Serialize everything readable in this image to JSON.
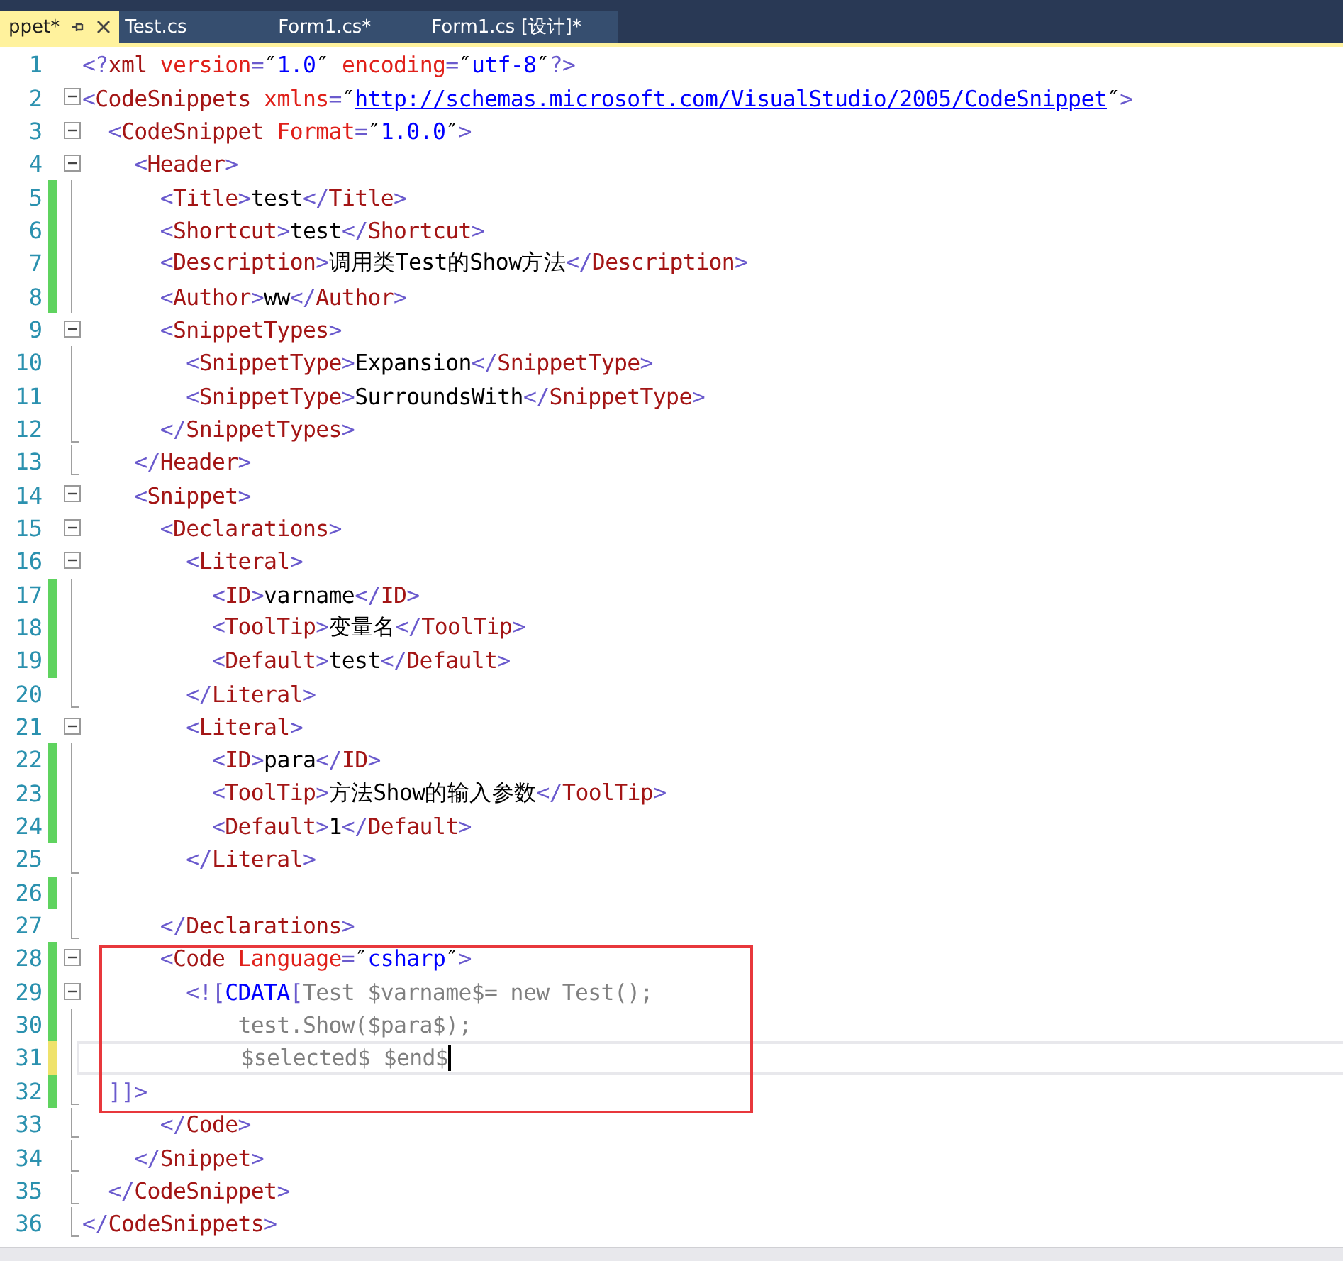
{
  "tabs": [
    {
      "label": "ppet*",
      "selected": true,
      "pinned": true
    },
    {
      "label": "Test.cs",
      "selected": false,
      "pinned": false
    },
    {
      "label": "Form1.cs*",
      "selected": false,
      "pinned": false
    },
    {
      "label": "Form1.cs [设计]*",
      "selected": false,
      "pinned": false
    }
  ],
  "lines": [
    {
      "number": "1",
      "tokens": [
        {
          "kind": "delim",
          "text": "<?"
        },
        {
          "kind": "tag",
          "text": "xml"
        },
        {
          "kind": "attr",
          "text": " version"
        },
        {
          "kind": "delim",
          "text": "="
        },
        {
          "kind": "quote",
          "text": "″"
        },
        {
          "kind": "value",
          "text": "1.0"
        },
        {
          "kind": "quote",
          "text": "″"
        },
        {
          "kind": "attr",
          "text": " encoding"
        },
        {
          "kind": "delim",
          "text": "="
        },
        {
          "kind": "quote",
          "text": "″"
        },
        {
          "kind": "value",
          "text": "utf-8"
        },
        {
          "kind": "quote",
          "text": "″"
        },
        {
          "kind": "delim",
          "text": "?>"
        }
      ]
    },
    {
      "number": "2",
      "collapsible": true,
      "tokens": [
        {
          "kind": "delim",
          "text": "<"
        },
        {
          "kind": "tag",
          "text": "CodeSnippets"
        },
        {
          "kind": "attr",
          "text": " xmlns"
        },
        {
          "kind": "delim",
          "text": "="
        },
        {
          "kind": "quote",
          "text": "″"
        },
        {
          "kind": "link",
          "text": "http://schemas.microsoft.com/VisualStudio/2005/CodeSnippet"
        },
        {
          "kind": "quote",
          "text": "″"
        },
        {
          "kind": "delim",
          "text": ">"
        }
      ]
    },
    {
      "number": "3",
      "collapsible": true,
      "tokens": [
        {
          "kind": "delim",
          "text": "  <"
        },
        {
          "kind": "tag",
          "text": "CodeSnippet"
        },
        {
          "kind": "attr",
          "text": " Format"
        },
        {
          "kind": "delim",
          "text": "="
        },
        {
          "kind": "quote",
          "text": "″"
        },
        {
          "kind": "value",
          "text": "1.0.0"
        },
        {
          "kind": "quote",
          "text": "″"
        },
        {
          "kind": "delim",
          "text": ">"
        }
      ]
    },
    {
      "number": "4",
      "collapsible": true,
      "tokens": [
        {
          "kind": "delim",
          "text": "    <"
        },
        {
          "kind": "tag",
          "text": "Header"
        },
        {
          "kind": "delim",
          "text": ">"
        }
      ]
    },
    {
      "number": "5",
      "modified": true,
      "saved": true,
      "tokens": [
        {
          "kind": "delim",
          "text": "      <"
        },
        {
          "kind": "tag",
          "text": "Title"
        },
        {
          "kind": "delim",
          "text": ">"
        },
        {
          "kind": "text",
          "text": "test"
        },
        {
          "kind": "delim",
          "text": "</"
        },
        {
          "kind": "tag",
          "text": "Title"
        },
        {
          "kind": "delim",
          "text": ">"
        }
      ]
    },
    {
      "number": "6",
      "modified": true,
      "saved": true,
      "tokens": [
        {
          "kind": "delim",
          "text": "      <"
        },
        {
          "kind": "tag",
          "text": "Shortcut"
        },
        {
          "kind": "delim",
          "text": ">"
        },
        {
          "kind": "text",
          "text": "test"
        },
        {
          "kind": "delim",
          "text": "</"
        },
        {
          "kind": "tag",
          "text": "Shortcut"
        },
        {
          "kind": "delim",
          "text": ">"
        }
      ]
    },
    {
      "number": "7",
      "modified": true,
      "saved": true,
      "tokens": [
        {
          "kind": "delim",
          "text": "      <"
        },
        {
          "kind": "tag",
          "text": "Description"
        },
        {
          "kind": "delim",
          "text": ">"
        },
        {
          "kind": "text",
          "text": "调用类Test的Show方法"
        },
        {
          "kind": "delim",
          "text": "</"
        },
        {
          "kind": "tag",
          "text": "Description"
        },
        {
          "kind": "delim",
          "text": ">"
        }
      ]
    },
    {
      "number": "8",
      "modified": true,
      "saved": true,
      "tokens": [
        {
          "kind": "delim",
          "text": "      <"
        },
        {
          "kind": "tag",
          "text": "Author"
        },
        {
          "kind": "delim",
          "text": ">"
        },
        {
          "kind": "text",
          "text": "ww"
        },
        {
          "kind": "delim",
          "text": "</"
        },
        {
          "kind": "tag",
          "text": "Author"
        },
        {
          "kind": "delim",
          "text": ">"
        }
      ]
    },
    {
      "number": "9",
      "collapsible": true,
      "tokens": [
        {
          "kind": "delim",
          "text": "      <"
        },
        {
          "kind": "tag",
          "text": "SnippetTypes"
        },
        {
          "kind": "delim",
          "text": ">"
        }
      ]
    },
    {
      "number": "10",
      "tokens": [
        {
          "kind": "delim",
          "text": "        <"
        },
        {
          "kind": "tag",
          "text": "SnippetType"
        },
        {
          "kind": "delim",
          "text": ">"
        },
        {
          "kind": "text",
          "text": "Expansion"
        },
        {
          "kind": "delim",
          "text": "</"
        },
        {
          "kind": "tag",
          "text": "SnippetType"
        },
        {
          "kind": "delim",
          "text": ">"
        }
      ]
    },
    {
      "number": "11",
      "tokens": [
        {
          "kind": "delim",
          "text": "        <"
        },
        {
          "kind": "tag",
          "text": "SnippetType"
        },
        {
          "kind": "delim",
          "text": ">"
        },
        {
          "kind": "text",
          "text": "SurroundsWith"
        },
        {
          "kind": "delim",
          "text": "</"
        },
        {
          "kind": "tag",
          "text": "SnippetType"
        },
        {
          "kind": "delim",
          "text": ">"
        }
      ]
    },
    {
      "number": "12",
      "closes_block": true,
      "tokens": [
        {
          "kind": "delim",
          "text": "      </"
        },
        {
          "kind": "tag",
          "text": "SnippetTypes"
        },
        {
          "kind": "delim",
          "text": ">"
        }
      ]
    },
    {
      "number": "13",
      "closes_block": true,
      "tokens": [
        {
          "kind": "delim",
          "text": "    </"
        },
        {
          "kind": "tag",
          "text": "Header"
        },
        {
          "kind": "delim",
          "text": ">"
        }
      ]
    },
    {
      "number": "14",
      "collapsible": true,
      "tokens": [
        {
          "kind": "delim",
          "text": "    <"
        },
        {
          "kind": "tag",
          "text": "Snippet"
        },
        {
          "kind": "delim",
          "text": ">"
        }
      ]
    },
    {
      "number": "15",
      "collapsible": true,
      "tokens": [
        {
          "kind": "delim",
          "text": "      <"
        },
        {
          "kind": "tag",
          "text": "Declarations"
        },
        {
          "kind": "delim",
          "text": ">"
        }
      ]
    },
    {
      "number": "16",
      "collapsible": true,
      "tokens": [
        {
          "kind": "delim",
          "text": "        <"
        },
        {
          "kind": "tag",
          "text": "Literal"
        },
        {
          "kind": "delim",
          "text": ">"
        }
      ]
    },
    {
      "number": "17",
      "modified": true,
      "saved": true,
      "tokens": [
        {
          "kind": "delim",
          "text": "          <"
        },
        {
          "kind": "tag",
          "text": "ID"
        },
        {
          "kind": "delim",
          "text": ">"
        },
        {
          "kind": "text",
          "text": "varname"
        },
        {
          "kind": "delim",
          "text": "</"
        },
        {
          "kind": "tag",
          "text": "ID"
        },
        {
          "kind": "delim",
          "text": ">"
        }
      ]
    },
    {
      "number": "18",
      "modified": true,
      "saved": true,
      "tokens": [
        {
          "kind": "delim",
          "text": "          <"
        },
        {
          "kind": "tag",
          "text": "ToolTip"
        },
        {
          "kind": "delim",
          "text": ">"
        },
        {
          "kind": "text",
          "text": "变量名"
        },
        {
          "kind": "delim",
          "text": "</"
        },
        {
          "kind": "tag",
          "text": "ToolTip"
        },
        {
          "kind": "delim",
          "text": ">"
        }
      ]
    },
    {
      "number": "19",
      "modified": true,
      "saved": true,
      "tokens": [
        {
          "kind": "delim",
          "text": "          <"
        },
        {
          "kind": "tag",
          "text": "Default"
        },
        {
          "kind": "delim",
          "text": ">"
        },
        {
          "kind": "text",
          "text": "test"
        },
        {
          "kind": "delim",
          "text": "</"
        },
        {
          "kind": "tag",
          "text": "Default"
        },
        {
          "kind": "delim",
          "text": ">"
        }
      ]
    },
    {
      "number": "20",
      "closes_block": true,
      "tokens": [
        {
          "kind": "delim",
          "text": "        </"
        },
        {
          "kind": "tag",
          "text": "Literal"
        },
        {
          "kind": "delim",
          "text": ">"
        }
      ]
    },
    {
      "number": "21",
      "collapsible": true,
      "tokens": [
        {
          "kind": "delim",
          "text": "        <"
        },
        {
          "kind": "tag",
          "text": "Literal"
        },
        {
          "kind": "delim",
          "text": ">"
        }
      ]
    },
    {
      "number": "22",
      "modified": true,
      "saved": true,
      "tokens": [
        {
          "kind": "delim",
          "text": "          <"
        },
        {
          "kind": "tag",
          "text": "ID"
        },
        {
          "kind": "delim",
          "text": ">"
        },
        {
          "kind": "text",
          "text": "para"
        },
        {
          "kind": "delim",
          "text": "</"
        },
        {
          "kind": "tag",
          "text": "ID"
        },
        {
          "kind": "delim",
          "text": ">"
        }
      ]
    },
    {
      "number": "23",
      "modified": true,
      "saved": true,
      "tokens": [
        {
          "kind": "delim",
          "text": "          <"
        },
        {
          "kind": "tag",
          "text": "ToolTip"
        },
        {
          "kind": "delim",
          "text": ">"
        },
        {
          "kind": "text",
          "text": "方法Show的输入参数"
        },
        {
          "kind": "delim",
          "text": "</"
        },
        {
          "kind": "tag",
          "text": "ToolTip"
        },
        {
          "kind": "delim",
          "text": ">"
        }
      ]
    },
    {
      "number": "24",
      "modified": true,
      "saved": true,
      "tokens": [
        {
          "kind": "delim",
          "text": "          <"
        },
        {
          "kind": "tag",
          "text": "Default"
        },
        {
          "kind": "delim",
          "text": ">"
        },
        {
          "kind": "text",
          "text": "1"
        },
        {
          "kind": "delim",
          "text": "</"
        },
        {
          "kind": "tag",
          "text": "Default"
        },
        {
          "kind": "delim",
          "text": ">"
        }
      ]
    },
    {
      "number": "25",
      "closes_block": true,
      "tokens": [
        {
          "kind": "delim",
          "text": "        </"
        },
        {
          "kind": "tag",
          "text": "Literal"
        },
        {
          "kind": "delim",
          "text": ">"
        }
      ]
    },
    {
      "number": "26",
      "modified": true,
      "saved": true
    },
    {
      "number": "27",
      "closes_block": true,
      "tokens": [
        {
          "kind": "delim",
          "text": "      </"
        },
        {
          "kind": "tag",
          "text": "Declarations"
        },
        {
          "kind": "delim",
          "text": ">"
        }
      ]
    },
    {
      "number": "28",
      "modified": true,
      "saved": true,
      "collapsible": true,
      "boxed": true,
      "tokens": [
        {
          "kind": "delim",
          "text": "      <"
        },
        {
          "kind": "tag",
          "text": "Code"
        },
        {
          "kind": "attr",
          "text": " Language"
        },
        {
          "kind": "delim",
          "text": "="
        },
        {
          "kind": "quote",
          "text": "″"
        },
        {
          "kind": "value",
          "text": "csharp"
        },
        {
          "kind": "quote",
          "text": "″"
        },
        {
          "kind": "delim",
          "text": ">"
        }
      ]
    },
    {
      "number": "29",
      "modified": true,
      "saved": true,
      "collapsible": true,
      "boxed": true,
      "tokens": [
        {
          "kind": "delim",
          "text": "        <!["
        },
        {
          "kind": "cdata",
          "text": "CDATA"
        },
        {
          "kind": "delim",
          "text": "["
        },
        {
          "kind": "code",
          "text": "Test $varname$= new Test();"
        }
      ]
    },
    {
      "number": "30",
      "modified": true,
      "saved": true,
      "boxed": true,
      "tokens": [
        {
          "kind": "code",
          "text": "            test.Show($para$);"
        }
      ]
    },
    {
      "number": "31",
      "modified": true,
      "saved": false,
      "boxed": true,
      "current": true,
      "tokens": [
        {
          "kind": "code",
          "text": "            $selected$ $end$"
        }
      ]
    },
    {
      "number": "32",
      "modified": true,
      "saved": true,
      "closes_block": true,
      "boxed": true,
      "tokens": [
        {
          "kind": "delim",
          "text": "  ]]>"
        }
      ]
    },
    {
      "number": "33",
      "closes_block": true,
      "tokens": [
        {
          "kind": "delim",
          "text": "      </"
        },
        {
          "kind": "tag",
          "text": "Code"
        },
        {
          "kind": "delim",
          "text": ">"
        }
      ]
    },
    {
      "number": "34",
      "closes_block": true,
      "tokens": [
        {
          "kind": "delim",
          "text": "    </"
        },
        {
          "kind": "tag",
          "text": "Snippet"
        },
        {
          "kind": "delim",
          "text": ">"
        }
      ]
    },
    {
      "number": "35",
      "closes_block": true,
      "tokens": [
        {
          "kind": "delim",
          "text": "  </"
        },
        {
          "kind": "tag",
          "text": "CodeSnippet"
        },
        {
          "kind": "delim",
          "text": ">"
        }
      ]
    },
    {
      "number": "36",
      "closes_block": true,
      "tokens": [
        {
          "kind": "delim",
          "text": "</"
        },
        {
          "kind": "tag",
          "text": "CodeSnippets"
        },
        {
          "kind": "delim",
          "text": ">"
        }
      ]
    }
  ]
}
